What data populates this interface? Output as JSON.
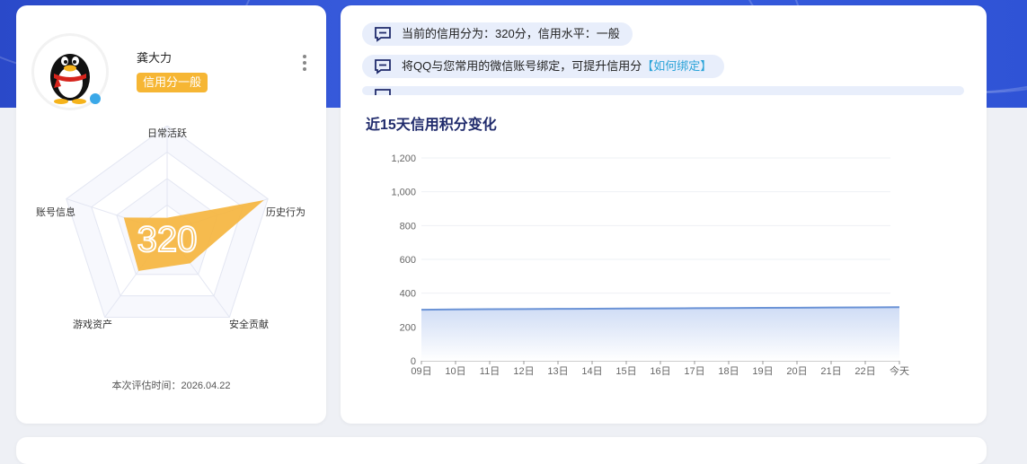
{
  "profile": {
    "name": "龚大力",
    "credit_level_badge": "信用分一般",
    "evaluation_time": "本次评估时间：2026.04.22"
  },
  "radar": {
    "score_text": "320",
    "axes": [
      "日常活跃",
      "历史行为",
      "安全贡献",
      "游戏资产",
      "账号信息"
    ],
    "values": [
      0.13,
      0.96,
      0.37,
      0.46,
      0.43
    ],
    "fill_color": "#f5b53f"
  },
  "notices": [
    {
      "text": "当前的信用分为：320分，信用水平：一般",
      "link": ""
    },
    {
      "text": "将QQ与您常用的微信账号绑定，可提升信用分",
      "link": "【如何绑定】"
    }
  ],
  "chart_title": "近15天信用积分变化",
  "chart_data": {
    "type": "area",
    "title": "近15天信用积分变化",
    "categories": [
      "09日",
      "10日",
      "11日",
      "12日",
      "13日",
      "14日",
      "15日",
      "16日",
      "17日",
      "18日",
      "19日",
      "20日",
      "21日",
      "22日",
      "今天"
    ],
    "values": [
      302,
      304,
      305,
      306,
      307,
      308,
      309,
      310,
      311,
      312,
      313,
      314,
      315,
      316,
      317
    ],
    "ylim": [
      0,
      1200
    ],
    "yticks": [
      "0",
      "200",
      "400",
      "600",
      "800",
      "1,000",
      "1,200"
    ],
    "line_color": "#6b93d6",
    "fill_color": "#dbe5f8",
    "grid": true
  }
}
